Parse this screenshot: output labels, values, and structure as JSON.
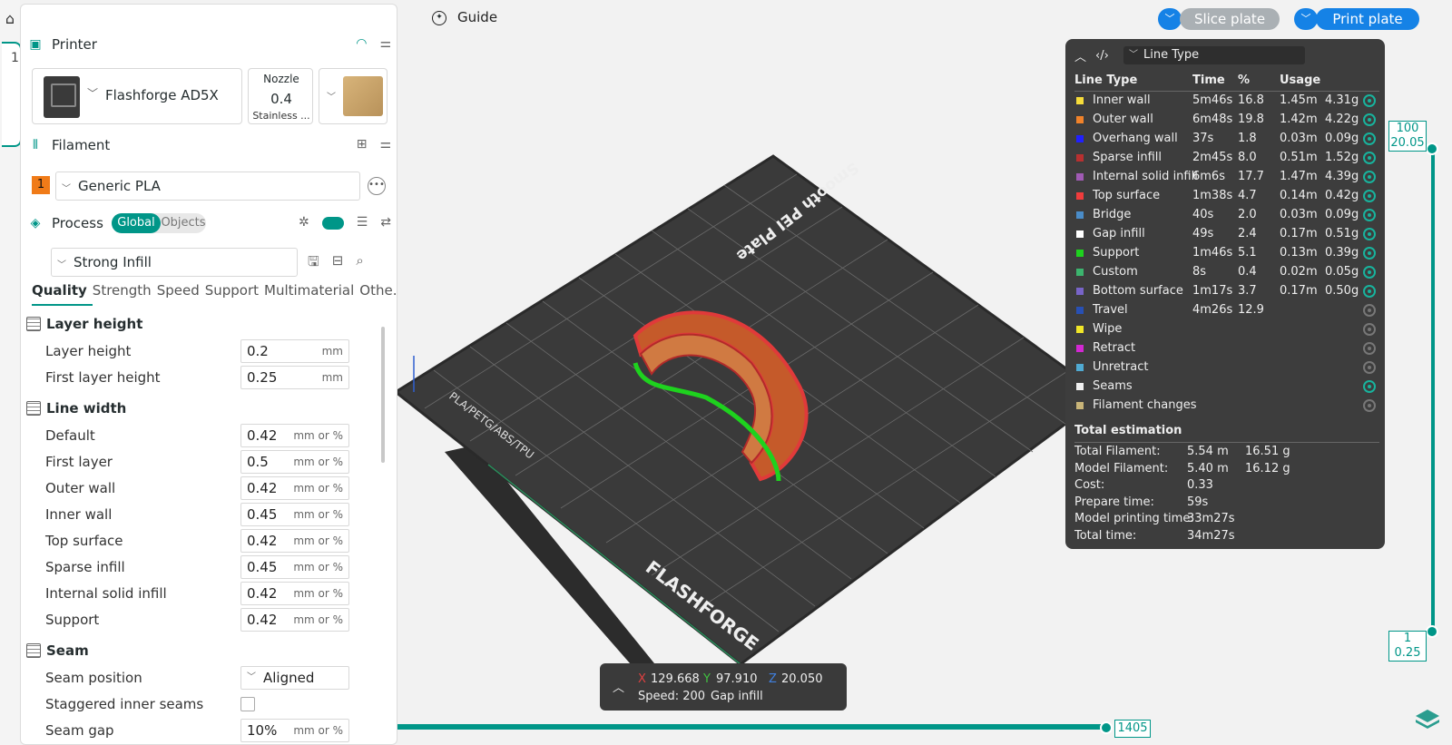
{
  "left_edge": {
    "tab_number": "1"
  },
  "printer": {
    "section_title": "Printer",
    "name": "Flashforge AD5X",
    "nozzle_title": "Nozzle",
    "nozzle_value": "0.4",
    "nozzle_type": "Stainless ..."
  },
  "filament": {
    "section_title": "Filament",
    "slot": "1",
    "name": "Generic PLA"
  },
  "process": {
    "section_title": "Process",
    "toggle_global": "Global",
    "toggle_objects": "Objects",
    "preset": "Strong Infill",
    "tabs": [
      "Quality",
      "Strength",
      "Speed",
      "Support",
      "Multimaterial",
      "Othe..."
    ]
  },
  "settings": {
    "layer_height_group": "Layer height",
    "line_width_group": "Line width",
    "seam_group": "Seam",
    "rows": [
      {
        "label": "Layer height",
        "value": "0.2",
        "unit": "mm"
      },
      {
        "label": "First layer height",
        "value": "0.25",
        "unit": "mm"
      },
      {
        "label": "Default",
        "value": "0.42",
        "unit": "mm or %"
      },
      {
        "label": "First layer",
        "value": "0.5",
        "unit": "mm or %"
      },
      {
        "label": "Outer wall",
        "value": "0.42",
        "unit": "mm or %"
      },
      {
        "label": "Inner wall",
        "value": "0.45",
        "unit": "mm or %"
      },
      {
        "label": "Top surface",
        "value": "0.42",
        "unit": "mm or %"
      },
      {
        "label": "Sparse infill",
        "value": "0.45",
        "unit": "mm or %"
      },
      {
        "label": "Internal solid infill",
        "value": "0.42",
        "unit": "mm or %"
      },
      {
        "label": "Support",
        "value": "0.42",
        "unit": "mm or %"
      },
      {
        "label": "Seam position",
        "value": "Aligned",
        "unit": ""
      },
      {
        "label": "Staggered inner seams",
        "value": "",
        "unit": ""
      },
      {
        "label": "Seam gap",
        "value": "10%",
        "unit": "mm or %"
      }
    ]
  },
  "toolbar": {
    "guide": "Guide",
    "slice": "Slice plate",
    "print": "Print plate"
  },
  "legend": {
    "view_mode": "Line Type",
    "headers": [
      "Line Type",
      "Time",
      "%",
      "Usage"
    ],
    "rows": [
      {
        "name": "Inner wall",
        "time": "5m46s",
        "pct": "16.8",
        "len": "1.45m",
        "g": "4.31g",
        "color": "#f6dc3a",
        "visible": true
      },
      {
        "name": "Outer wall",
        "time": "6m48s",
        "pct": "19.8",
        "len": "1.42m",
        "g": "4.22g",
        "color": "#f0822a",
        "visible": true
      },
      {
        "name": "Overhang wall",
        "time": "37s",
        "pct": "1.8",
        "len": "0.03m",
        "g": "0.09g",
        "color": "#2020ff",
        "visible": true
      },
      {
        "name": "Sparse infill",
        "time": "2m45s",
        "pct": "8.0",
        "len": "0.51m",
        "g": "1.52g",
        "color": "#b83030",
        "visible": true
      },
      {
        "name": "Internal solid infill",
        "time": "6m6s",
        "pct": "17.7",
        "len": "1.47m",
        "g": "4.39g",
        "color": "#a05ab4",
        "visible": true
      },
      {
        "name": "Top surface",
        "time": "1m38s",
        "pct": "4.7",
        "len": "0.14m",
        "g": "0.42g",
        "color": "#f03c3c",
        "visible": true
      },
      {
        "name": "Bridge",
        "time": "40s",
        "pct": "2.0",
        "len": "0.03m",
        "g": "0.09g",
        "color": "#4a8cc8",
        "visible": true
      },
      {
        "name": "Gap infill",
        "time": "49s",
        "pct": "2.4",
        "len": "0.17m",
        "g": "0.51g",
        "color": "#ffffff",
        "visible": true
      },
      {
        "name": "Support",
        "time": "1m46s",
        "pct": "5.1",
        "len": "0.13m",
        "g": "0.39g",
        "color": "#1ed21e",
        "visible": true
      },
      {
        "name": "Custom",
        "time": "8s",
        "pct": "0.4",
        "len": "0.02m",
        "g": "0.05g",
        "color": "#3cb46e",
        "visible": true
      },
      {
        "name": "Bottom surface",
        "time": "1m17s",
        "pct": "3.7",
        "len": "0.17m",
        "g": "0.50g",
        "color": "#7864c8",
        "visible": true
      },
      {
        "name": "Travel",
        "time": "4m26s",
        "pct": "12.9",
        "len": "",
        "g": "",
        "color": "#2850b4",
        "visible": false
      },
      {
        "name": "Wipe",
        "time": "",
        "pct": "",
        "len": "",
        "g": "",
        "color": "#f0e628",
        "visible": false
      },
      {
        "name": "Retract",
        "time": "",
        "pct": "",
        "len": "",
        "g": "",
        "color": "#d228d2",
        "visible": false
      },
      {
        "name": "Unretract",
        "time": "",
        "pct": "",
        "len": "",
        "g": "",
        "color": "#50aad2",
        "visible": false
      },
      {
        "name": "Seams",
        "time": "",
        "pct": "",
        "len": "",
        "g": "",
        "color": "#f0f0f0",
        "visible": true
      },
      {
        "name": "Filament changes",
        "time": "",
        "pct": "",
        "len": "",
        "g": "",
        "color": "#c8b478",
        "visible": false
      }
    ],
    "totals_title": "Total estimation",
    "totals": [
      {
        "k": "Total Filament:",
        "v": "5.54 m",
        "w": "16.51 g"
      },
      {
        "k": "Model Filament:",
        "v": "5.40 m",
        "w": "16.12 g"
      },
      {
        "k": "Cost:",
        "v": "0.33",
        "w": ""
      },
      {
        "k": "Prepare time:",
        "v": "59s",
        "w": ""
      },
      {
        "k": "Model printing time:",
        "v": "33m27s",
        "w": ""
      },
      {
        "k": "Total time:",
        "v": "34m27s",
        "w": ""
      }
    ]
  },
  "vslider": {
    "top_layer": "100",
    "top_z": "20.05",
    "bottom_layer": "1",
    "bottom_z": "0.25"
  },
  "hslider": {
    "value": "1405"
  },
  "coords": {
    "x": "129.668",
    "y": "97.910",
    "z": "20.050",
    "speed": "Speed: 200",
    "type": "Gap infill"
  },
  "plate": {
    "label": "Smooth PEI Plate",
    "brand": "FLASHFORGE",
    "material": "PLA/PETG/ABS/TPU"
  }
}
